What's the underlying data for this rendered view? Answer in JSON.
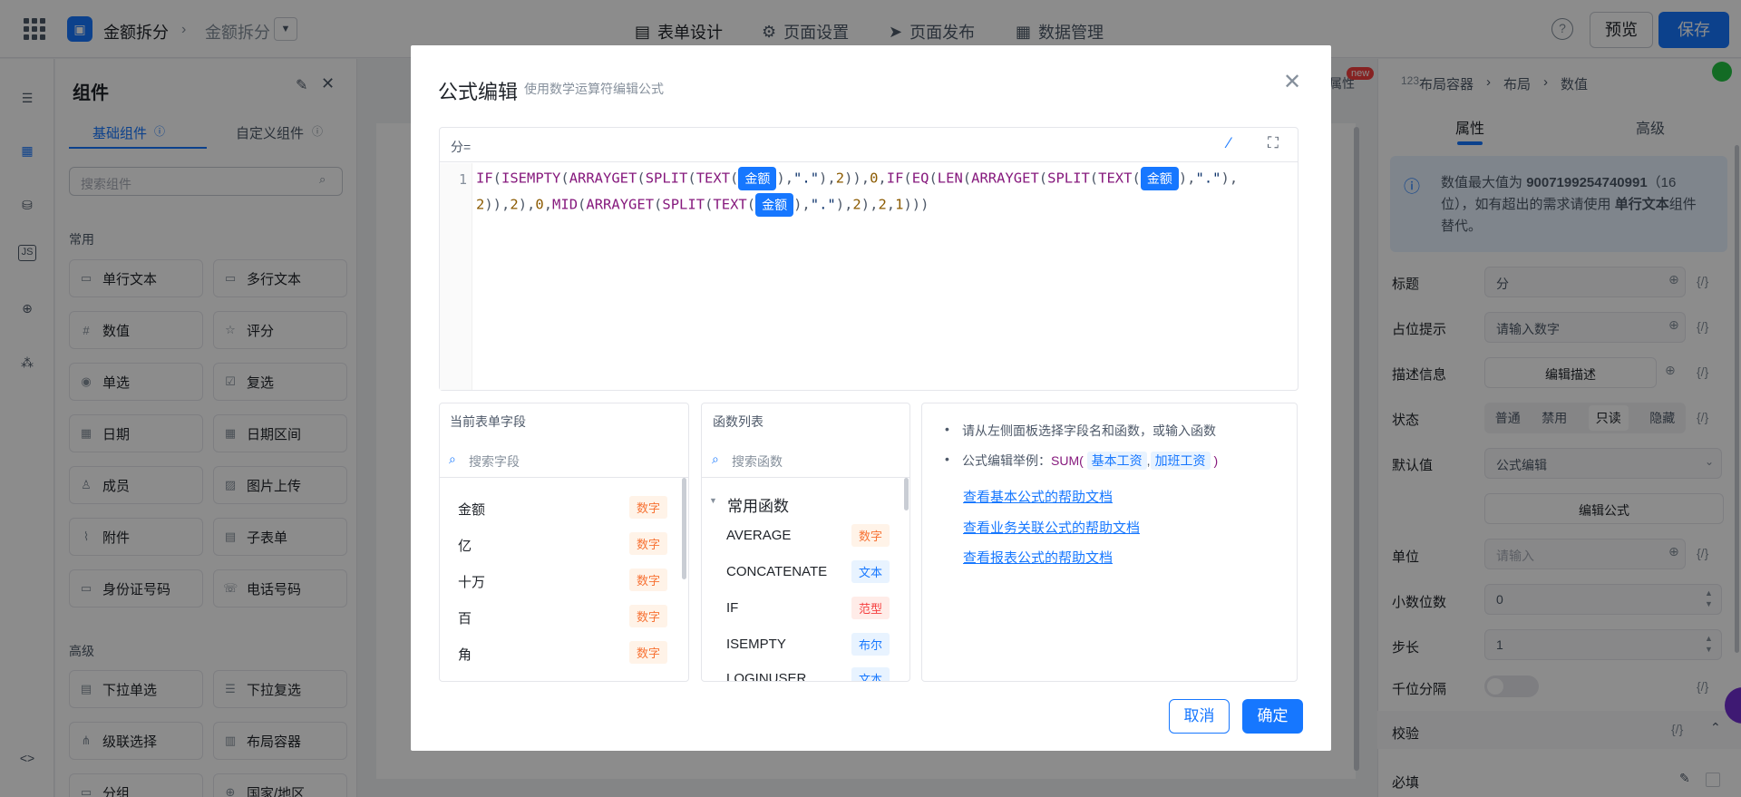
{
  "topbar": {
    "app_name": "金额拆分",
    "form_name": "金额拆分",
    "tabs": [
      {
        "label": "表单设计",
        "icon": "document-icon"
      },
      {
        "label": "页面设置",
        "icon": "gear-icon"
      },
      {
        "label": "页面发布",
        "icon": "send-icon"
      },
      {
        "label": "数据管理",
        "icon": "table-icon"
      }
    ],
    "preview": "预览",
    "save": "保存"
  },
  "components": {
    "title": "组件",
    "tab_basic": "基础组件",
    "tab_custom": "自定义组件",
    "search_placeholder": "搜索组件",
    "section_common": "常用",
    "section_advanced": "高级",
    "common": [
      "单行文本",
      "多行文本",
      "数值",
      "评分",
      "单选",
      "复选",
      "日期",
      "日期区间",
      "成员",
      "图片上传",
      "附件",
      "子表单",
      "身份证号码",
      "电话号码"
    ],
    "advanced": [
      "下拉单选",
      "下拉复选",
      "级联选择",
      "布局容器",
      "分组",
      "国家/地区"
    ]
  },
  "right_panel": {
    "props_hint": "属性",
    "new_badge": "new",
    "breadcrumb": [
      "布局容器",
      "布局",
      "数值"
    ],
    "tab_props": "属性",
    "tab_advanced": "高级",
    "info_pre": "数值最大值为",
    "info_value": "9007199254740991",
    "info_mid": "（16位），如有超出的需求请使用",
    "info_component": "单行文本",
    "info_post": "组件替代。",
    "labels": {
      "title": "标题",
      "placeholder": "占位提示",
      "desc": "描述信息",
      "state": "状态",
      "default": "默认值",
      "unit": "单位",
      "decimals": "小数位数",
      "step": "步长",
      "thousand": "千位分隔",
      "validation": "校验",
      "required": "必填"
    },
    "title_value": "分",
    "placeholder_value": "请输入数字",
    "desc_button": "编辑描述",
    "states": [
      "普通",
      "禁用",
      "只读",
      "隐藏"
    ],
    "default_value": "公式编辑",
    "edit_formula": "编辑公式",
    "unit_placeholder": "请输入",
    "decimals_value": "0",
    "step_value": "1",
    "fx": "{/}"
  },
  "modal": {
    "title": "公式编辑",
    "subtitle": "使用数学运算符编辑公式",
    "field_label": "分=",
    "line_number": "1",
    "field_token": "金额",
    "fields_title": "当前表单字段",
    "fields_search": "搜索字段",
    "fields": [
      {
        "name": "金额",
        "type": "数字"
      },
      {
        "name": "亿",
        "type": "数字"
      },
      {
        "name": "十万",
        "type": "数字"
      },
      {
        "name": "百",
        "type": "数字"
      },
      {
        "name": "角",
        "type": "数字"
      }
    ],
    "functions_title": "函数列表",
    "functions_search": "搜索函数",
    "functions_group": "常用函数",
    "functions": [
      {
        "name": "AVERAGE",
        "type": "数字"
      },
      {
        "name": "CONCATENATE",
        "type": "文本"
      },
      {
        "name": "IF",
        "type": "范型"
      },
      {
        "name": "ISEMPTY",
        "type": "布尔"
      },
      {
        "name": "LOGINUSER",
        "type": "文本"
      }
    ],
    "help_tip1": "请从左侧面板选择字段名和函数，或输入函数",
    "help_tip2_pre": "公式编辑举例：",
    "help_example_fn": "SUM(",
    "help_example_a": "基本工资",
    "help_example_b": "加班工资",
    "help_example_close": ")",
    "links": [
      "查看基本公式的帮助文档",
      "查看业务关联公式的帮助文档",
      "查看报表公式的帮助文档"
    ],
    "cancel": "取消",
    "ok": "确定"
  }
}
